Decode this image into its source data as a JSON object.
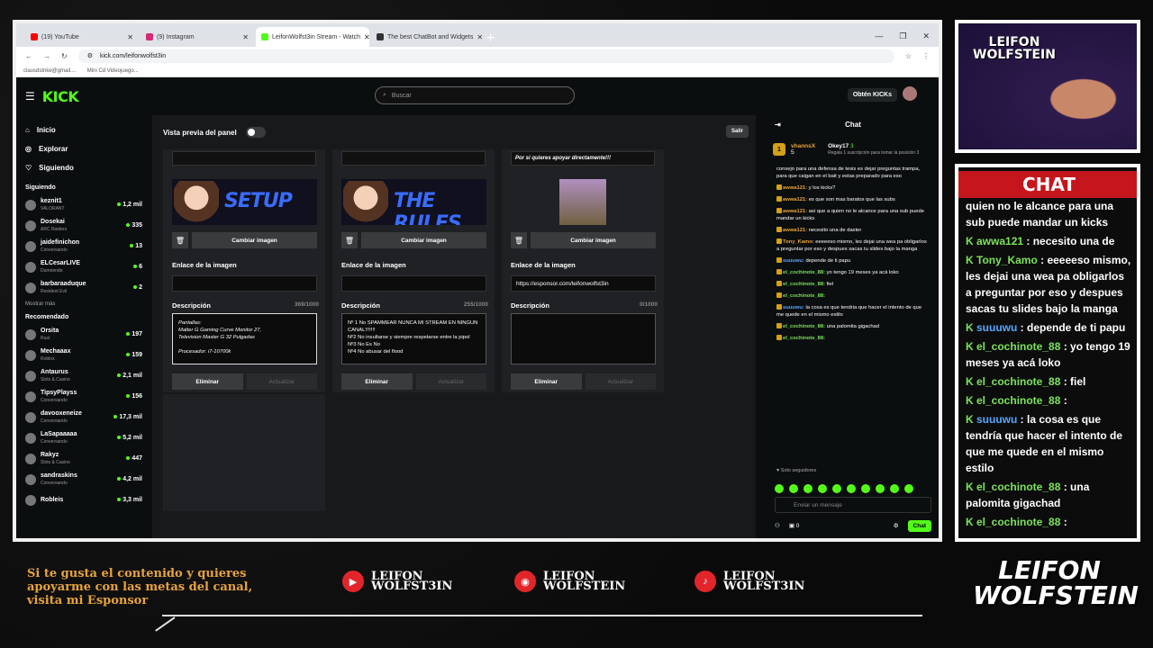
{
  "browser": {
    "tabs": [
      {
        "label": "(19) YouTube",
        "color": "#ff0000"
      },
      {
        "label": "(9) Instagram",
        "color": "#d62976"
      },
      {
        "label": "LeifonWolfst3in Stream - Watch",
        "color": "#53fc18"
      },
      {
        "label": "The best ChatBot and Widgets",
        "color": "#333333"
      }
    ],
    "url": "kick.com/leifonwolfst3in",
    "bookmarks": [
      "clausdstrike@gmail....",
      "Mini Cd Videojuego..."
    ]
  },
  "kick": {
    "logo": "KICK",
    "search_placeholder": "Buscar",
    "get_kicks": "Obtén KICKs",
    "nav": [
      {
        "label": "Inicio",
        "icon": "home-icon",
        "glyph": "⌂"
      },
      {
        "label": "Explorar",
        "icon": "compass-icon",
        "glyph": "◎"
      },
      {
        "label": "Siguiendo",
        "icon": "heart-icon",
        "glyph": "♡"
      }
    ],
    "following_title": "Siguiendo",
    "following": [
      {
        "name": "keznit1",
        "cat": "VALORANT",
        "viewers": "1,2 mil"
      },
      {
        "name": "Dosekai",
        "cat": "ARC Raiders",
        "viewers": "335"
      },
      {
        "name": "jaidefinichon",
        "cat": "Conversando",
        "viewers": "13"
      },
      {
        "name": "ELCesarLIVE",
        "cat": "Durmiendo",
        "viewers": "6"
      },
      {
        "name": "barbaraaduque",
        "cat": "Resident Evil",
        "viewers": "2"
      }
    ],
    "show_more": "Mostrar más",
    "recommended_title": "Recomendado",
    "recommended": [
      {
        "name": "Orsita",
        "cat": "Rust",
        "viewers": "197"
      },
      {
        "name": "Mechaaax",
        "cat": "Roblox",
        "viewers": "159"
      },
      {
        "name": "Antaurus",
        "cat": "Slots & Casino",
        "viewers": "2,1 mil"
      },
      {
        "name": "TipsyPlayss",
        "cat": "Conversando",
        "viewers": "156"
      },
      {
        "name": "davooxeneize",
        "cat": "Conversando",
        "viewers": "17,3 mil"
      },
      {
        "name": "LaSapaaaaa",
        "cat": "Conversando",
        "viewers": "5,2 mil"
      },
      {
        "name": "Rakyz",
        "cat": "Slots & Casino",
        "viewers": "447"
      },
      {
        "name": "sandraskins",
        "cat": "Conversando",
        "viewers": "4,2 mil"
      },
      {
        "name": "Robleis",
        "cat": "",
        "viewers": "3,3 mil"
      }
    ],
    "panel": {
      "preview_label": "Vista previa del panel",
      "exit": "Salir",
      "change_image": "Cambiar imagen",
      "link_label": "Enlace de la imagen",
      "desc_label": "Descripción",
      "delete": "Eliminar",
      "update": "Actualizar",
      "cards": [
        {
          "top_text": "",
          "banner": "SETUP",
          "link": "",
          "count": "369/1000",
          "desc": "Pantallas:\nMatter G Gaming Curve Monitor 27,\nTelevision Master G 32 Pulgadas\n\nProcesador: i7-10700k"
        },
        {
          "top_text": "",
          "banner": "THE RULES",
          "link": "",
          "count": "255/1000",
          "desc": "Nº 1 No SPAMMEAR NUNCA MI STREAM EN NINGUN CANAL!!!!!!!\nNº2 No insultarse y siempre respetarse entre la pipol\nNº3 No Es No\nNº4 No abusar del flood"
        },
        {
          "top_text": "Por si quieres apoyar directamente!!!",
          "banner": "",
          "link": "https://esponsor.com/leifonwolfst3in",
          "count": "0/1000",
          "desc": ""
        }
      ]
    },
    "chat": {
      "title": "Chat",
      "pinned_user": "vhannsX",
      "pinned_num": "5",
      "gift_user": "Okey17",
      "gift_num": "3",
      "gift_text": "Regala 1 suscripción para tomar la posición 3",
      "messages": [
        {
          "user": "",
          "text": "consejo para una defensa de tesis es dejar preguntas trampa, para que caigan en el bait y estas preparado para eso",
          "color": "#ffffff"
        },
        {
          "user": "awwa121:",
          "text": "y los kicks?",
          "color": "#e8a33b"
        },
        {
          "user": "awwa121:",
          "text": "es que son mas baratos que las subs",
          "color": "#e8a33b"
        },
        {
          "user": "awwa121:",
          "text": "asi que a quien no le alcance para una sub puede mandar un kicks",
          "color": "#e8a33b"
        },
        {
          "user": "awwa121:",
          "text": "necesito una de daxter",
          "color": "#e8a33b"
        },
        {
          "user": "Tony_Kamo:",
          "text": "eeeeeso mismo, les dejai una wea pa obligarlos a preguntar por eso y despues sacas tu slides bajo la manga",
          "color": "#e8a33b"
        },
        {
          "user": "suuuwu:",
          "text": "depende de ti papu",
          "color": "#54a8ff"
        },
        {
          "user": "el_cochinote_88:",
          "text": "yo tengo 19 meses ya acá loko",
          "color": "#7ce25c"
        },
        {
          "user": "el_cochinote_88:",
          "text": "fiel",
          "color": "#7ce25c"
        },
        {
          "user": "el_cochinote_88:",
          "text": "",
          "color": "#7ce25c"
        },
        {
          "user": "suuuwu:",
          "text": "la cosa es que tendria que hacer el intento de que me quede en el mismo estilo",
          "color": "#54a8ff"
        },
        {
          "user": "el_cochinote_88:",
          "text": "una palomita gigachad",
          "color": "#7ce25c"
        },
        {
          "user": "el_cochinote_88:",
          "text": "",
          "color": "#7ce25c"
        }
      ],
      "followers_only": "Solo seguidores",
      "input_placeholder": "Enviar un mensaje",
      "kicks_count": "0",
      "send": "Chat"
    }
  },
  "overlay": {
    "cam_title": "LEIFON\nWOLFSTEIN",
    "chat_banner": "CHAT",
    "messages": [
      {
        "user": "",
        "text": "quien no le alcance para una sub puede mandar un kicks",
        "blue": false
      },
      {
        "user": "awwa121",
        "text": ": necesito una de",
        "blue": false
      },
      {
        "user": "Tony_Kamo",
        "text": ": eeeeeso mismo, les dejai una wea pa obligarlos a preguntar por eso y despues sacas tu slides bajo la manga",
        "blue": false
      },
      {
        "user": "suuuwu",
        "text": ": depende de ti papu",
        "blue": true
      },
      {
        "user": "el_cochinote_88",
        "text": ": yo tengo 19 meses ya acá loko",
        "blue": false
      },
      {
        "user": "el_cochinote_88",
        "text": ": fiel",
        "blue": false
      },
      {
        "user": "el_cochinote_88",
        "text": ":",
        "blue": false
      },
      {
        "user": "suuuwu",
        "text": ": la cosa es que tendría que hacer el intento de que me quede en el mismo estilo",
        "blue": true
      },
      {
        "user": "el_cochinote_88",
        "text": ": una palomita gigachad",
        "blue": false
      },
      {
        "user": "el_cochinote_88",
        "text": ":",
        "blue": false
      }
    ],
    "bottom_text": "Si te gusta el contenido y quieres apoyarme con las metas del canal, visita mi Esponsor",
    "socials": [
      {
        "icon": "youtube-icon",
        "glyph": "▶",
        "text": "LEIFON\nWOLFST3IN",
        "color": "#e2252b"
      },
      {
        "icon": "instagram-icon",
        "glyph": "◉",
        "text": "LEIFON\nWOLFSTEIN",
        "color": "#e2252b"
      },
      {
        "icon": "tiktok-icon",
        "glyph": "♪",
        "text": "LEIFON\nWOLFST3IN",
        "color": "#e2252b"
      }
    ],
    "brand": "LEIFON\nWOLFSTEIN"
  }
}
